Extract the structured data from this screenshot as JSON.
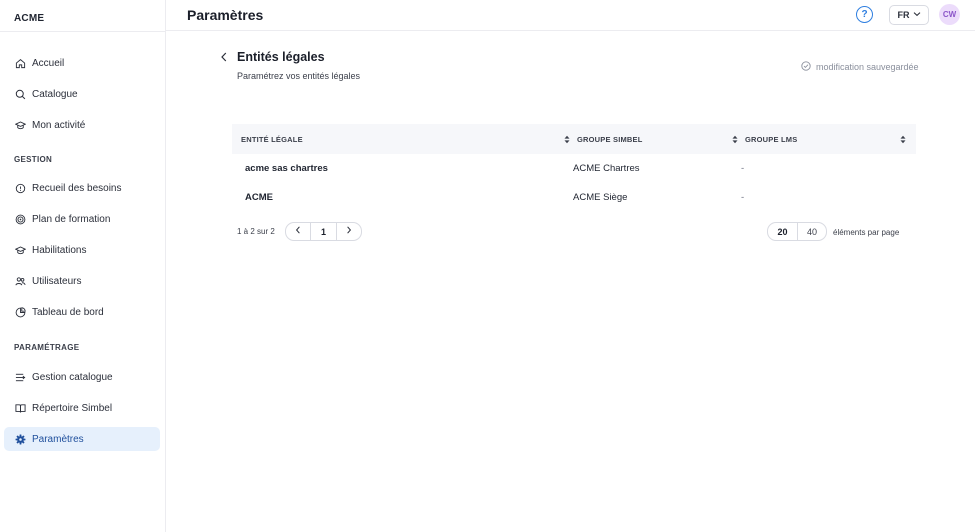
{
  "sidebar": {
    "brand": "ACME",
    "items_main": [
      {
        "label": "Accueil",
        "icon": "home-icon"
      },
      {
        "label": "Catalogue",
        "icon": "search-icon"
      },
      {
        "label": "Mon activité",
        "icon": "graduation-cap-icon"
      }
    ],
    "section_gestion": "GESTION",
    "items_gestion": [
      {
        "label": "Recueil des besoins",
        "icon": "chat-bubble-icon"
      },
      {
        "label": "Plan de formation",
        "icon": "target-icon"
      },
      {
        "label": "Habilitations",
        "icon": "graduation-cap-icon"
      },
      {
        "label": "Utilisateurs",
        "icon": "users-icon"
      },
      {
        "label": "Tableau de bord",
        "icon": "pie-chart-icon"
      }
    ],
    "section_parametrage": "PARAMÉTRAGE",
    "items_parametrage": [
      {
        "label": "Gestion catalogue",
        "icon": "list-icon"
      },
      {
        "label": "Répertoire Simbel",
        "icon": "book-icon"
      },
      {
        "label": "Paramètres",
        "icon": "gear-icon",
        "active": true
      }
    ]
  },
  "topbar": {
    "title": "Paramètres",
    "help_glyph": "?",
    "language": "FR",
    "avatar_initials": "CW"
  },
  "content": {
    "title": "Entités légales",
    "subtitle": "Paramétrez vos entités légales",
    "save_status": "modification sauvegardée"
  },
  "table": {
    "columns": [
      "ENTITÉ LÉGALE",
      "GROUPE SIMBEL",
      "GROUPE LMS"
    ],
    "rows": [
      [
        "acme sas chartres",
        "ACME Chartres",
        "-"
      ],
      [
        "ACME",
        "ACME Siège",
        "-"
      ]
    ]
  },
  "pagination": {
    "info": "1 à 2 sur 2",
    "current_page": "1",
    "page_sizes": [
      "20",
      "40"
    ],
    "selected_page_size": "20",
    "page_size_label": "éléments par page"
  },
  "colors": {
    "accent": "#2f7fe0",
    "active_bg": "#e6f0fc",
    "avatar_bg": "#ecdcfb",
    "avatar_fg": "#8c56c9"
  }
}
